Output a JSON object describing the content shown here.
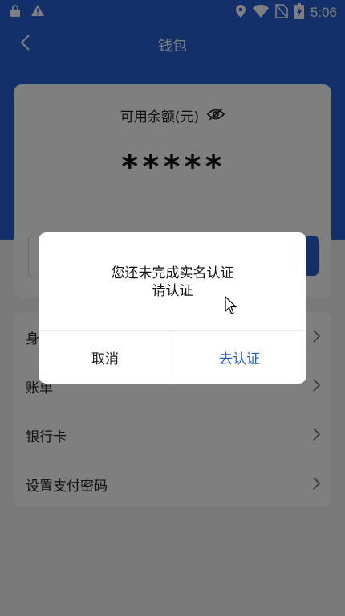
{
  "status_bar": {
    "time": "5:06",
    "left_icons": [
      "lock-icon",
      "warning-icon"
    ],
    "right_icons": [
      "location-icon",
      "wifi-icon",
      "no-sim-icon",
      "battery-charging-icon"
    ]
  },
  "navbar": {
    "title": "钱包",
    "back_icon": "chevron-left-icon"
  },
  "balance": {
    "label": "可用余额(元)",
    "visibility_icon": "eye-off-icon",
    "value": "*****"
  },
  "menu": {
    "items": [
      {
        "label": "身"
      },
      {
        "label": "账单"
      },
      {
        "label": "银行卡"
      },
      {
        "label": "设置支付密码"
      }
    ]
  },
  "dialog": {
    "message_line1": "您还未完成实名认证",
    "message_line2": "请认证",
    "cancel_label": "取消",
    "confirm_label": "去认证"
  },
  "colors": {
    "primary": "#2860d4",
    "overlay": "rgba(0,0,0,0.5)"
  }
}
